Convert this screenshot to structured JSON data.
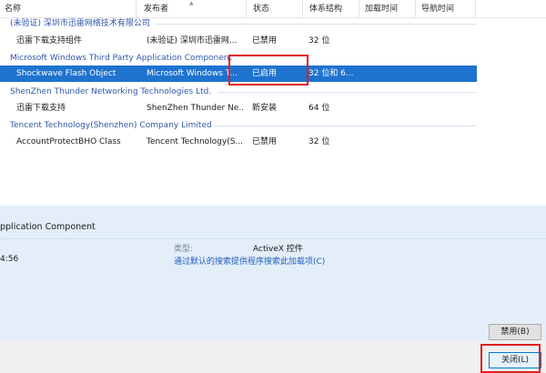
{
  "columns": [
    "名称",
    "发布者",
    "状态",
    "体系结构",
    "加载时间",
    "导航时间"
  ],
  "groups": [
    {
      "name": "(未验证) 深圳市迅雷网络技术有限公司",
      "rows": [
        {
          "name": "迅雷下载支持组件",
          "publisher": "(未验证) 深圳市迅雷网...",
          "status": "已禁用",
          "arch": "32 位",
          "selected": false
        }
      ]
    },
    {
      "name": "Microsoft Windows Third Party Application Component",
      "rows": [
        {
          "name": "Shockwave Flash Object",
          "publisher": "Microsoft Windows T...",
          "status": "已启用",
          "arch": "32 位和 6...",
          "selected": true
        }
      ]
    },
    {
      "name": "ShenZhen Thunder Networking Technologies Ltd.",
      "rows": [
        {
          "name": "迅雷下载支持",
          "publisher": "ShenZhen Thunder Ne...",
          "status": "新安装",
          "arch": "64 位",
          "selected": false
        }
      ]
    },
    {
      "name": "Tencent Technology(Shenzhen) Company Limited",
      "rows": [
        {
          "name": "AccountProtectBHO Class",
          "publisher": "Tencent Technology(S...",
          "status": "已禁用",
          "arch": "32 位",
          "selected": false
        }
      ]
    }
  ],
  "details": {
    "title": "pplication Component",
    "time": "4:56",
    "type_label": "类型:",
    "type_value": "ActiveX 控件",
    "search_link": "通过默认的搜索提供程序搜索此加载项(C)"
  },
  "buttons": {
    "disable": "禁用(B)",
    "close": "关闭(L)"
  },
  "colors": {
    "selection": "#1e73cf",
    "group_text": "#2f57a7",
    "highlight": "#e02020",
    "details_bg": "#e3eef9",
    "link": "#1f5fbf"
  }
}
